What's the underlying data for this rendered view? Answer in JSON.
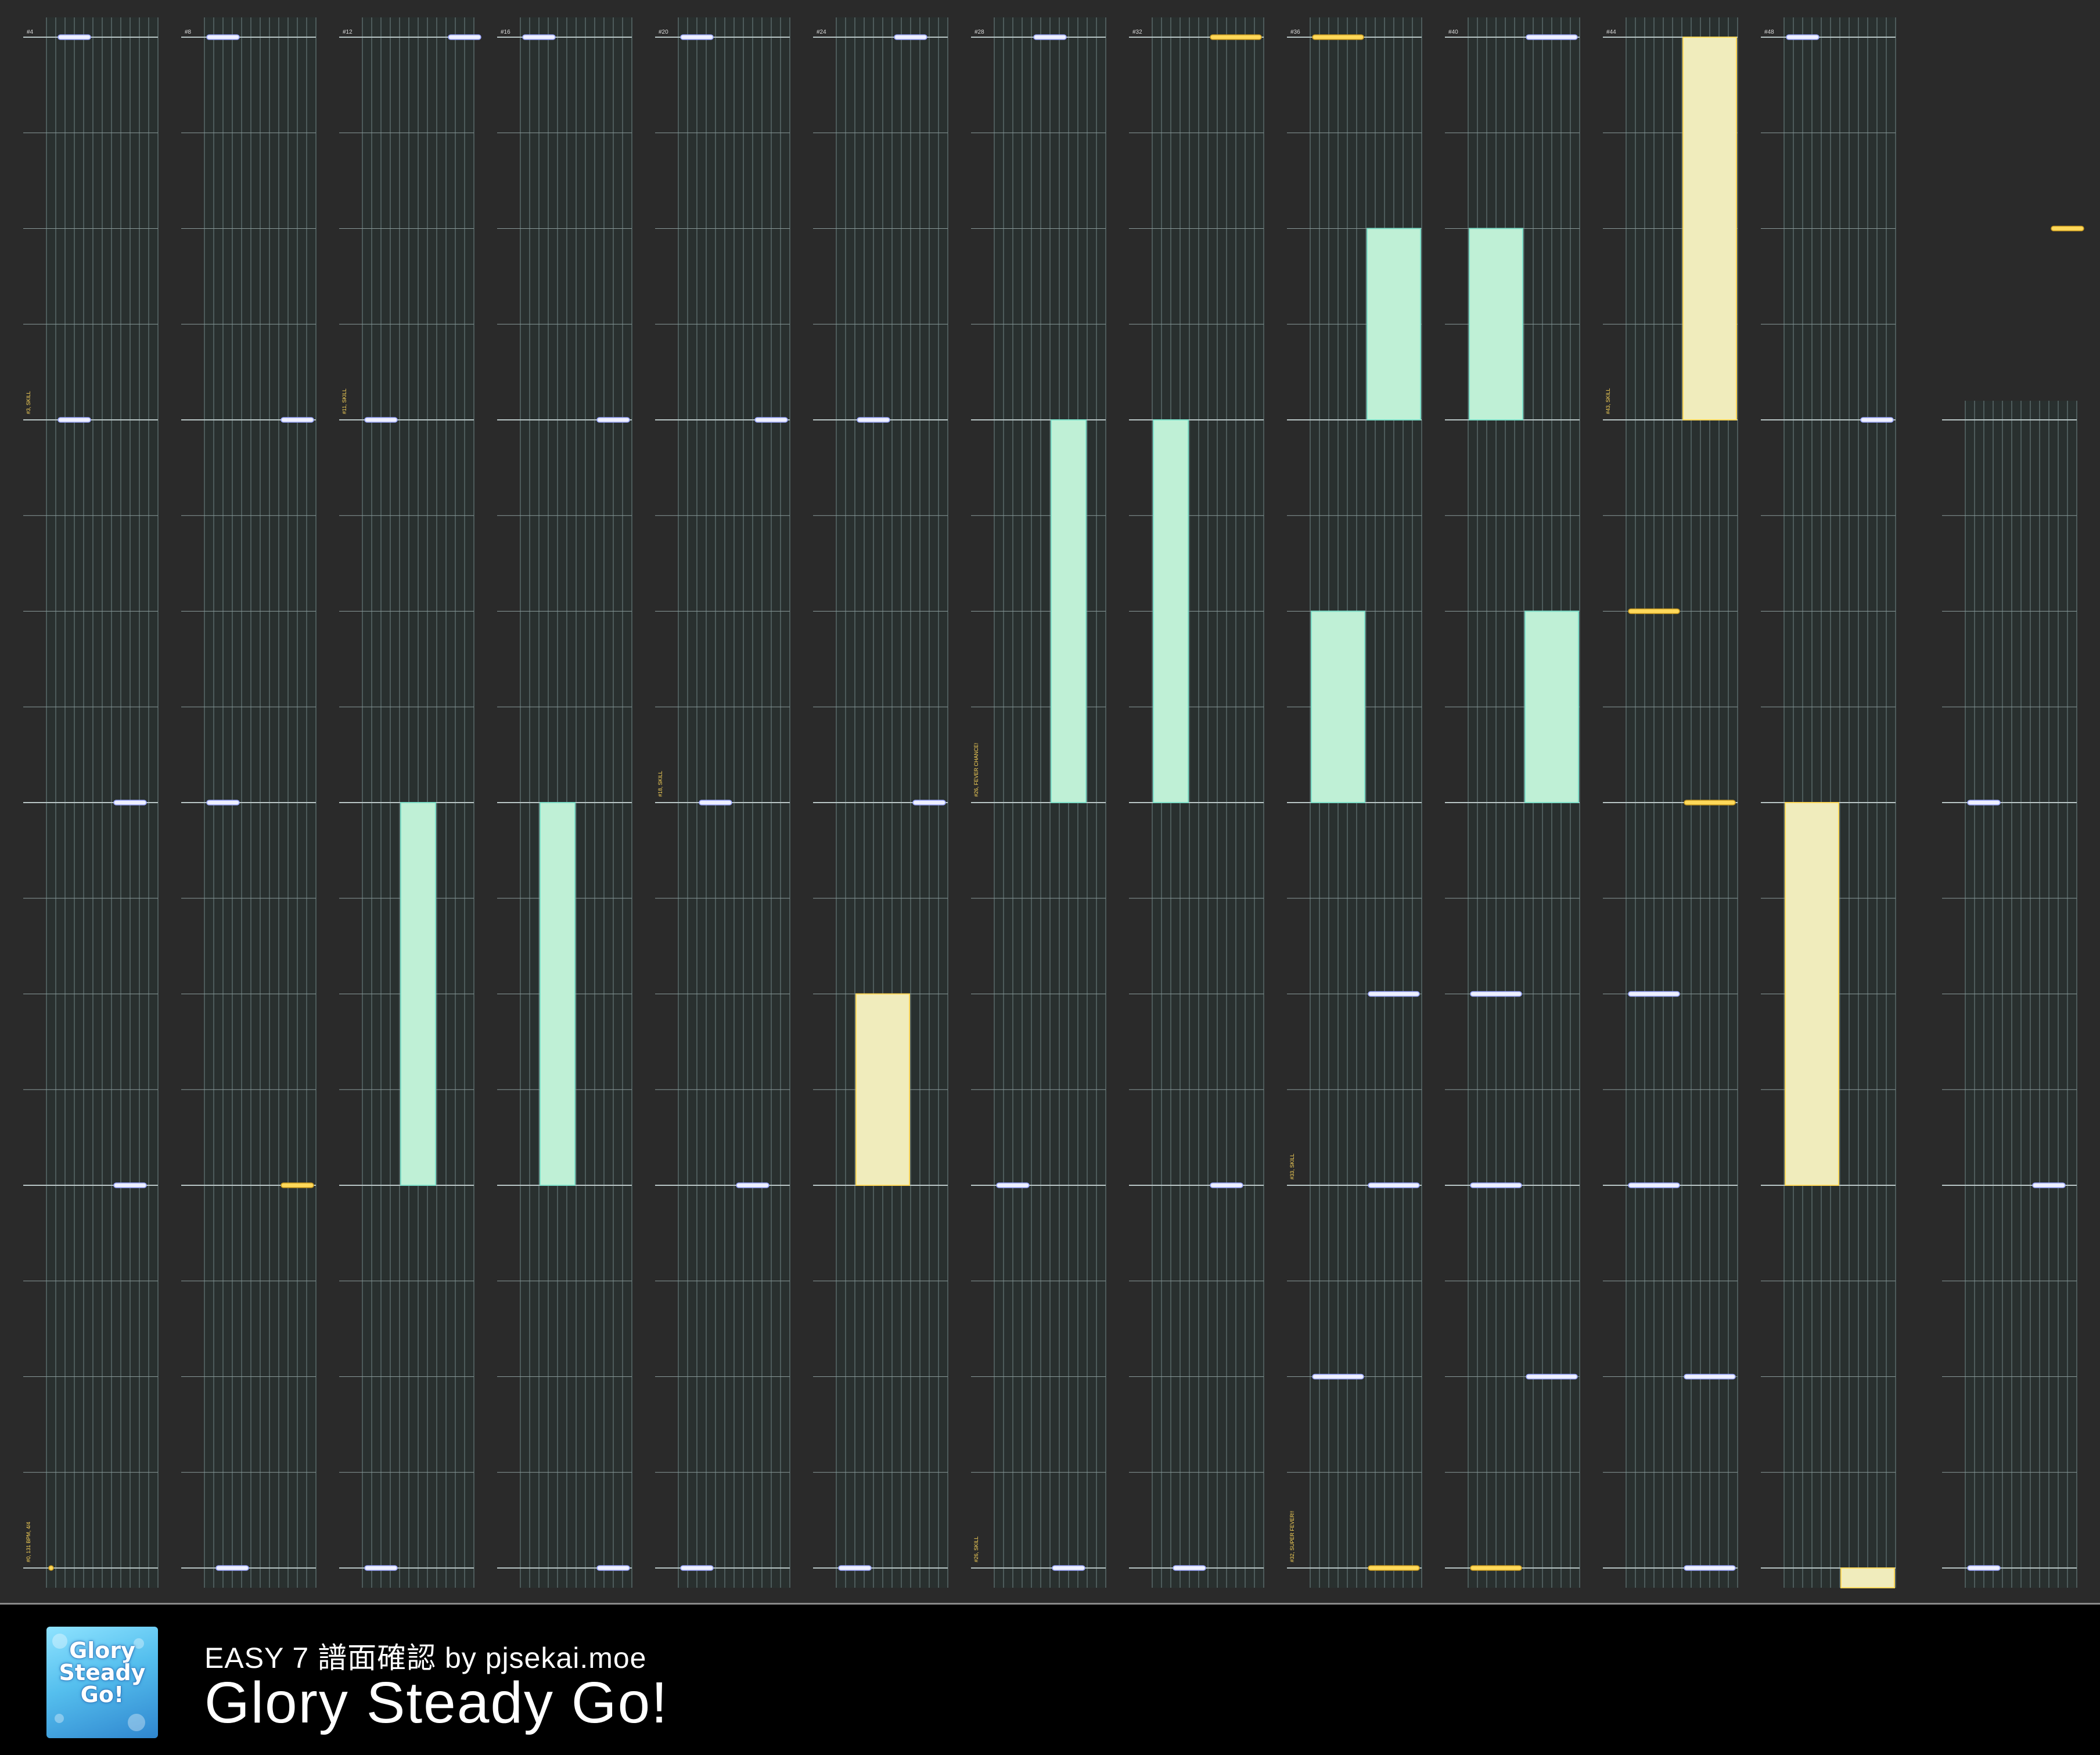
{
  "chart": {
    "background": "#2a2a2a",
    "lane_bg": "#29302f",
    "lane_line": "#4d5b5b",
    "beat_line": "#8a9a9a",
    "tap_color": "#eef0ff",
    "critical_color": "#ffd95a",
    "hold_fill": "#bff0d6",
    "hold_edge": "#7fe0c9",
    "critical_hold_fill": "#f0ecbc",
    "critical_hold_edge": "#ffd95a",
    "column_top_labels": [
      "#4",
      "#8",
      "#12",
      "#16",
      "#20",
      "#24",
      "#28",
      "#32",
      "#36",
      "#40",
      "#44",
      "#48"
    ],
    "event_labels": [
      "#0, 131 BPM, 4/4",
      "#3, SKILL",
      "#11, SKILL",
      "#18, SKILL",
      "#26, FEVER CHANCE!",
      "#26, SKILL",
      "#32, SUPER FEVER!!",
      "#33, SKILL",
      "#43, SKILL"
    ]
  },
  "footer": {
    "subtitle": "EASY 7 譜面確認 by pjsekai.moe",
    "title": "Glory Steady Go!",
    "jacket_logo": [
      "Glory",
      "Steady",
      "Go!"
    ]
  }
}
